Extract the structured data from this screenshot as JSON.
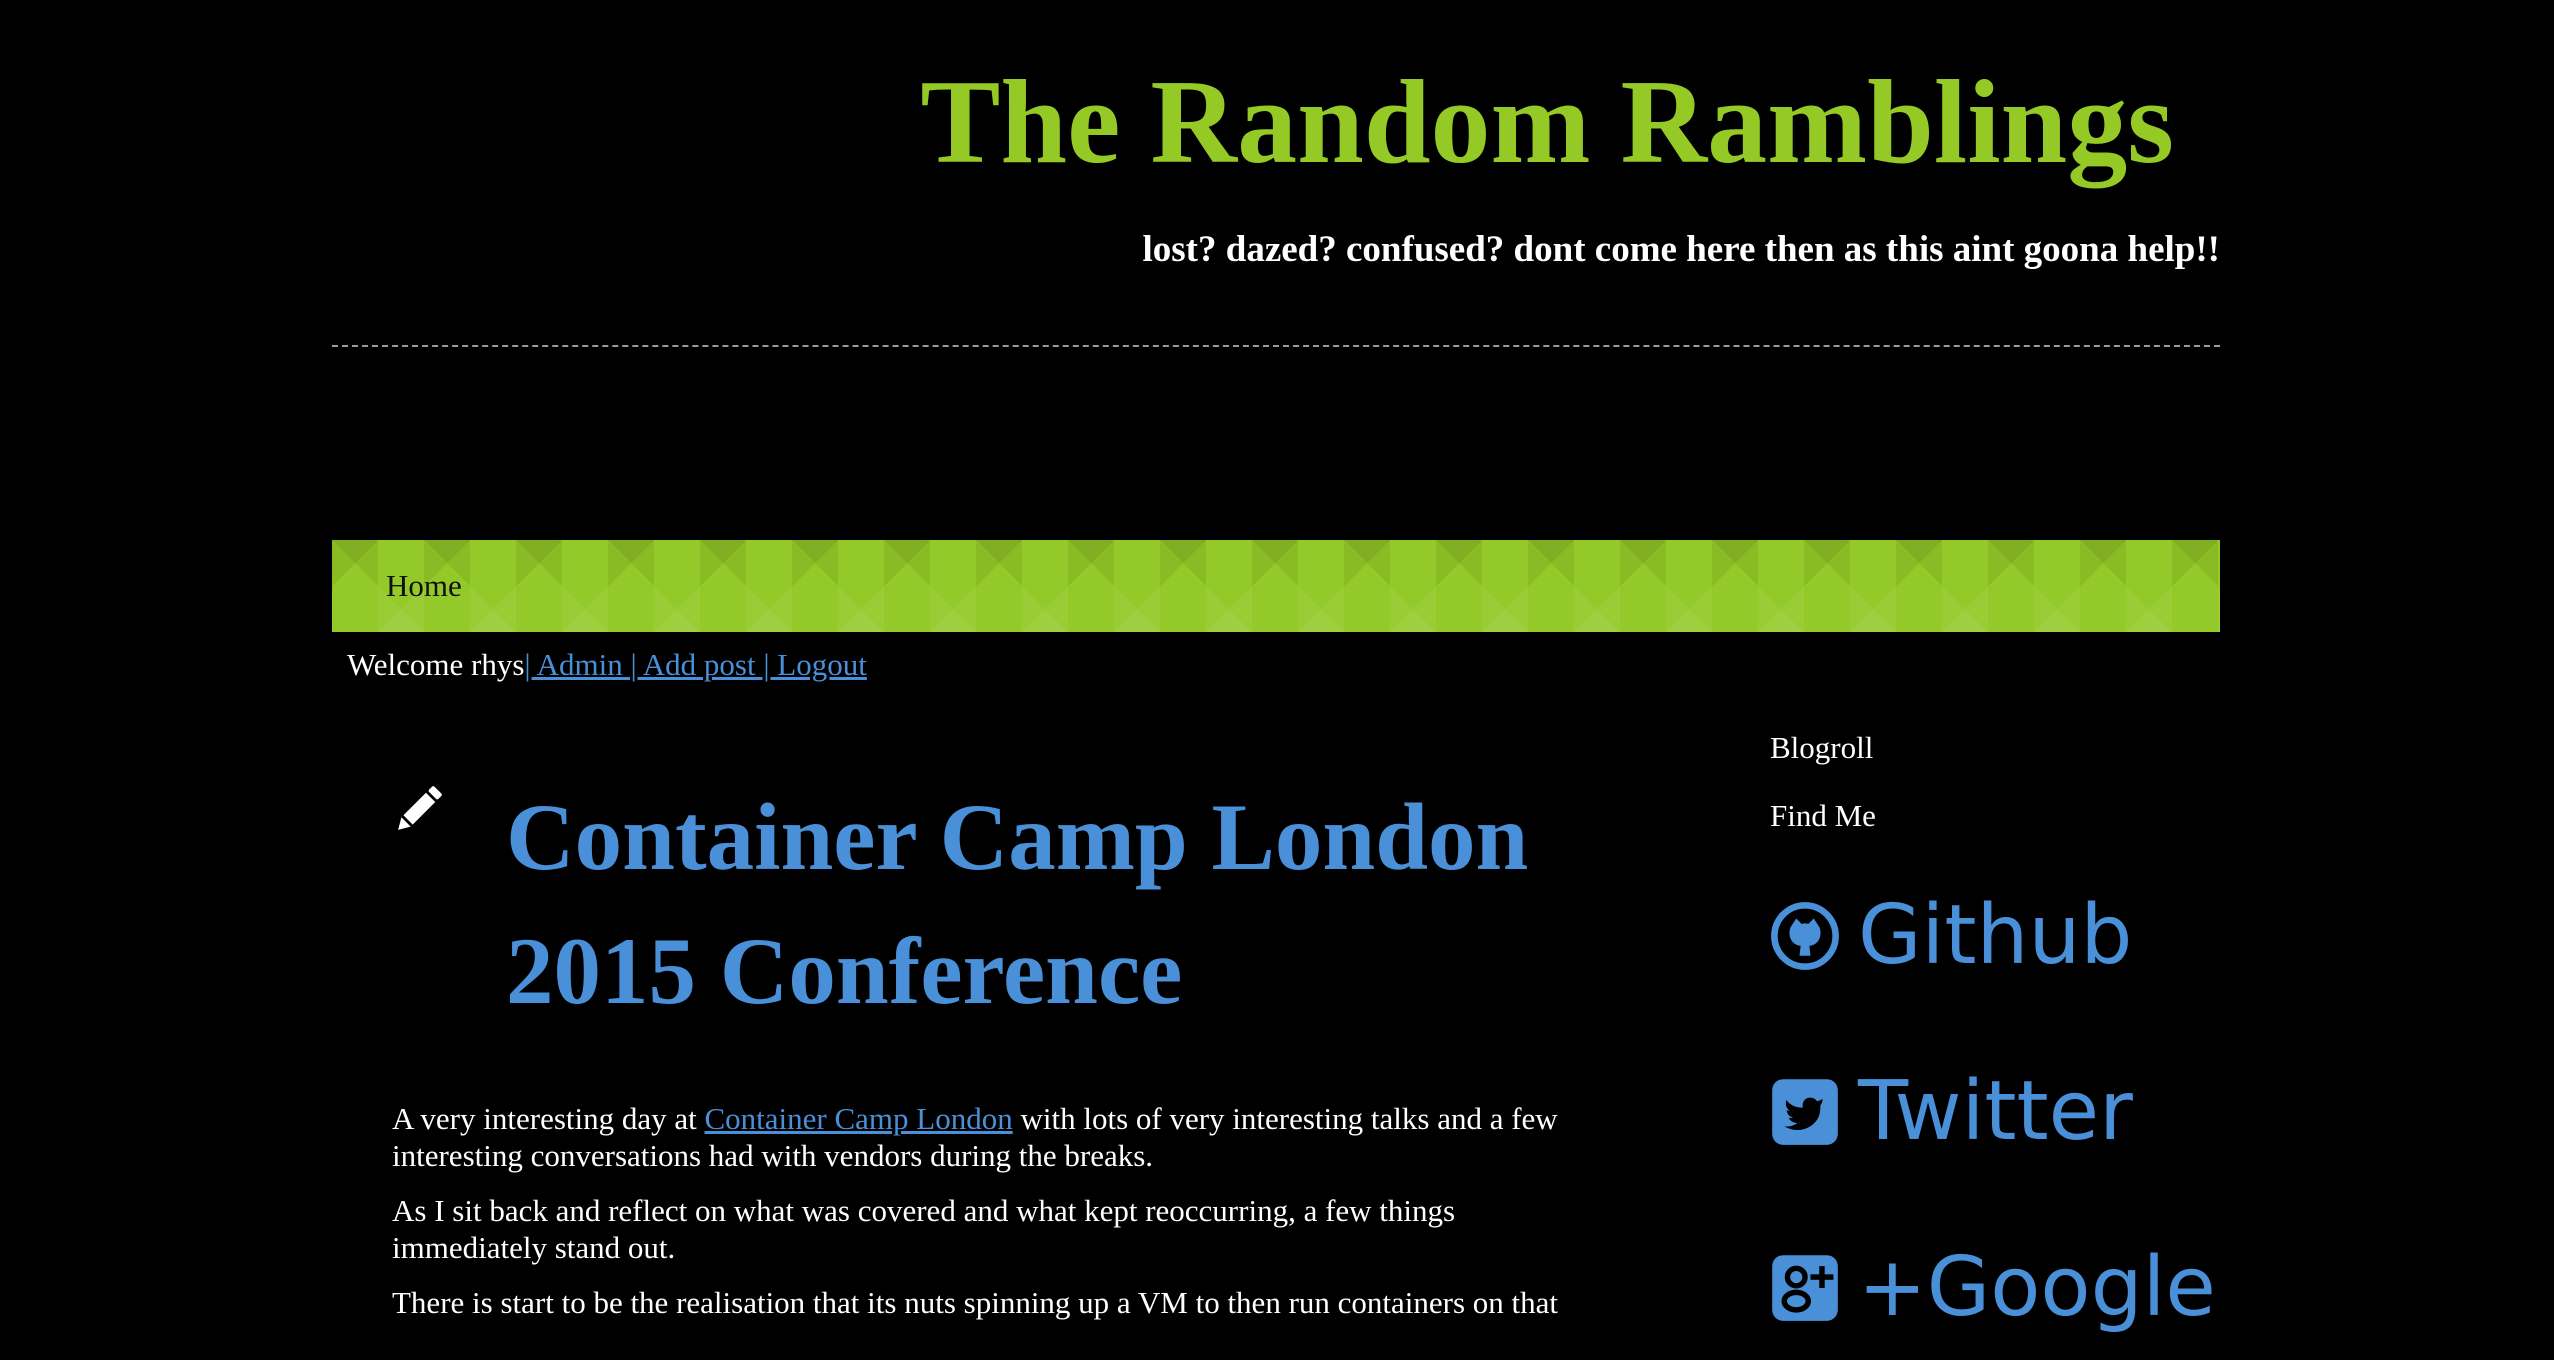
{
  "header": {
    "title": "The Random Ramblings",
    "tagline": "lost? dazed? confused? dont come here then as this aint goona help!!"
  },
  "nav": {
    "items": [
      {
        "label": "Home"
      }
    ]
  },
  "userbar": {
    "welcome": "Welcome rhys",
    "links_text": "| Admin | Add post | Logout"
  },
  "post": {
    "icon": "pencil-icon",
    "title": "Container Camp London 2015 Conference",
    "paragraphs": [
      {
        "before": "A very interesting day at ",
        "link": "Container Camp London",
        "after": " with lots of very interesting talks and a few interesting conversations had with vendors during the breaks."
      },
      {
        "text": "As I sit back and reflect on what was covered and what kept reoccurring, a few things immediately stand out."
      },
      {
        "text": "There is start to be the realisation that its nuts spinning up a VM to then run containers on that"
      }
    ]
  },
  "sidebar": {
    "blogroll": "Blogroll",
    "find_me": "Find Me",
    "social": [
      {
        "label": "Github",
        "icon": "github-icon"
      },
      {
        "label": "Twitter",
        "icon": "twitter-icon"
      },
      {
        "label": "+Google",
        "icon": "google-plus-icon"
      }
    ]
  },
  "colors": {
    "background": "#000000",
    "title_green": "#95c926",
    "nav_green": "#93c928",
    "link_blue": "#4a90d9",
    "text": "#ffffff"
  }
}
